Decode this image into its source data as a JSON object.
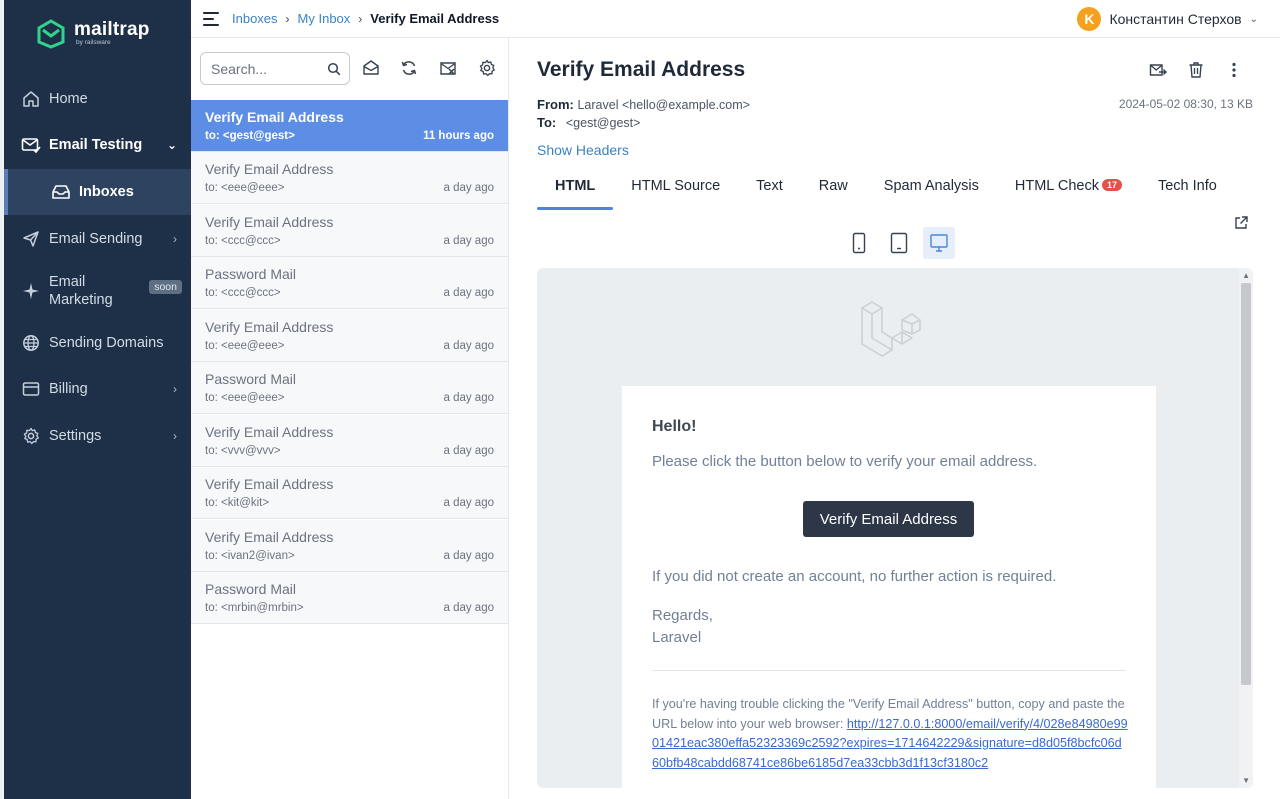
{
  "app": {
    "logo_name": "mailtrap",
    "logo_sub": "by railsware"
  },
  "sidebar": {
    "items": [
      {
        "label": "Home",
        "icon": "home-icon"
      },
      {
        "label": "Email Testing",
        "icon": "email-testing-icon"
      },
      {
        "label": "Inboxes",
        "icon": "inbox-icon"
      },
      {
        "label": "Email Sending",
        "icon": "send-icon"
      },
      {
        "label": "Email",
        "label2": "Marketing",
        "badge": "soon",
        "icon": "sparkle-icon"
      },
      {
        "label": "Sending Domains",
        "icon": "globe-icon"
      },
      {
        "label": "Billing",
        "icon": "billing-icon"
      },
      {
        "label": "Settings",
        "icon": "gear-icon"
      }
    ]
  },
  "header": {
    "breadcrumbs": [
      "Inboxes",
      "My Inbox",
      "Verify Email Address"
    ],
    "user_initial": "K",
    "user_name": "Константин Стерхов"
  },
  "list": {
    "search_placeholder": "Search...",
    "messages": [
      {
        "subject": "Verify Email Address",
        "to": "to: <gest@gest>",
        "time": "11 hours ago",
        "selected": true
      },
      {
        "subject": "Verify Email Address",
        "to": "to: <eee@eee>",
        "time": "a day ago"
      },
      {
        "subject": "Verify Email Address",
        "to": "to: <ccc@ccc>",
        "time": "a day ago"
      },
      {
        "subject": "Password Mail",
        "to": "to: <ccc@ccc>",
        "time": "a day ago"
      },
      {
        "subject": "Verify Email Address",
        "to": "to: <eee@eee>",
        "time": "a day ago"
      },
      {
        "subject": "Password Mail",
        "to": "to: <eee@eee>",
        "time": "a day ago"
      },
      {
        "subject": "Verify Email Address",
        "to": "to: <vvv@vvv>",
        "time": "a day ago"
      },
      {
        "subject": "Verify Email Address",
        "to": "to: <kit@kit>",
        "time": "a day ago"
      },
      {
        "subject": "Verify Email Address",
        "to": "to: <ivan2@ivan>",
        "time": "a day ago"
      },
      {
        "subject": "Password Mail",
        "to": "to: <mrbin@mrbin>",
        "time": "a day ago"
      }
    ]
  },
  "message": {
    "title": "Verify Email Address",
    "from_label": "From:",
    "from_value": "Laravel <hello@example.com>",
    "to_label": "To:",
    "to_value": "<gest@gest>",
    "date_size": "2024-05-02 08:30, 13 KB",
    "show_headers": "Show Headers",
    "tabs": [
      "HTML",
      "HTML Source",
      "Text",
      "Raw",
      "Spam Analysis",
      "HTML Check",
      "Tech Info"
    ],
    "html_check_count": "17"
  },
  "email_body": {
    "greeting": "Hello!",
    "intro": "Please click the button below to verify your email address.",
    "button": "Verify Email Address",
    "outro": "If you did not create an account, no further action is required.",
    "regards": "Regards,",
    "signature": "Laravel",
    "trouble_text": "If you're having trouble clicking the \"Verify Email Address\" button, copy and paste the URL below into your web browser: ",
    "url": "http://127.0.0.1:8000/email/verify/4/028e84980e9901421eac380effa52323369c2592?expires=1714642229&signature=d8d05f8bcfc06d60bfb48cabdd68741ce86be6185d7ea33cbb3d1f13cf3180c2"
  },
  "colors": {
    "sidebar_bg": "#1e3048",
    "selected_row": "#5d8ee6",
    "accent": "#3b82c4",
    "email_button": "#2d3748",
    "badge_red": "#e4504a"
  }
}
